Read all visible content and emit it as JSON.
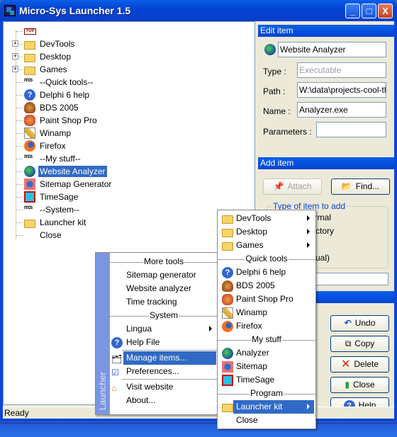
{
  "window": {
    "title": "Micro-Sys Launcher 1.5",
    "minimize": "_",
    "maximize": "□",
    "close": "X"
  },
  "tree": [
    {
      "label": "",
      "icon": "top-tag-icon",
      "tag": "TOP"
    },
    {
      "label": "DevTools",
      "icon": "folder-icon",
      "expandable": true
    },
    {
      "label": "Desktop",
      "icon": "folder-icon",
      "expandable": true
    },
    {
      "label": "Games",
      "icon": "folder-icon",
      "expandable": true
    },
    {
      "label": "--Quick tools--",
      "icon": "separator-icon",
      "tag": "m:s"
    },
    {
      "label": "Delphi 6 help",
      "icon": "help-icon"
    },
    {
      "label": "BDS 2005",
      "icon": "bds-icon"
    },
    {
      "label": "Paint Shop Pro",
      "icon": "paintshop-icon"
    },
    {
      "label": "Winamp",
      "icon": "winamp-icon"
    },
    {
      "label": "Firefox",
      "icon": "firefox-icon"
    },
    {
      "label": "--My stuff--",
      "icon": "separator-icon",
      "tag": "m:s"
    },
    {
      "label": "Website Analyzer",
      "icon": "globe-icon",
      "selected": true
    },
    {
      "label": "Sitemap Generator",
      "icon": "sitemap-icon"
    },
    {
      "label": "TimeSage",
      "icon": "timesage-icon"
    },
    {
      "label": "--System--",
      "icon": "separator-icon",
      "tag": "m:s"
    },
    {
      "label": "Launcher kit",
      "icon": "folder-icon"
    },
    {
      "label": "Close",
      "icon": ""
    }
  ],
  "edit": {
    "header": "Edit item",
    "title_value": "Website Analyzer",
    "type_label": "Type :",
    "type_value": "Executable",
    "path_label": "Path :",
    "path_value": "W:\\data\\projects-cool-th",
    "name_label": "Name :",
    "name_value": "Analyzer.exe",
    "params_label": "Parameters :",
    "params_value": ""
  },
  "add": {
    "header": "Add item",
    "attach": "Attach",
    "find": "Find...",
    "group_title": "Type of item to add",
    "radio_file": "File / normal",
    "radio_dir_partial": "ctory",
    "radio_virtual_partial": "ual)"
  },
  "buttons": {
    "undo": "Undo",
    "copy": "Copy",
    "delete": "Delete",
    "close": "Close",
    "help": "Help"
  },
  "status": {
    "text": "Ready"
  },
  "menu_main": {
    "side_label": "Launcher",
    "items": [
      {
        "type": "header",
        "label": "More tools"
      },
      {
        "type": "item",
        "label": "Sitemap generator"
      },
      {
        "type": "item",
        "label": "Website analyzer"
      },
      {
        "type": "item",
        "label": "Time tracking"
      },
      {
        "type": "header",
        "label": "System"
      },
      {
        "type": "item",
        "label": "Lingua",
        "submenu": true
      },
      {
        "type": "item",
        "label": "Help File",
        "icon": "help-icon"
      },
      {
        "type": "item",
        "label": "Manage items...",
        "icon": "manage-icon",
        "highlighted": true
      },
      {
        "type": "item",
        "label": "Preferences...",
        "icon": "preferences-icon"
      },
      {
        "type": "item",
        "label": "Visit website",
        "icon": "home-icon"
      },
      {
        "type": "item",
        "label": "About..."
      }
    ]
  },
  "menu_sub": {
    "items": [
      {
        "type": "item",
        "label": "DevTools",
        "icon": "folder-icon",
        "submenu": true
      },
      {
        "type": "item",
        "label": "Desktop",
        "icon": "folder-icon",
        "submenu": true
      },
      {
        "type": "item",
        "label": "Games",
        "icon": "folder-icon",
        "submenu": true
      },
      {
        "type": "header",
        "label": "Quick tools"
      },
      {
        "type": "item",
        "label": "Delphi 6 help",
        "icon": "help-icon"
      },
      {
        "type": "item",
        "label": "BDS 2005",
        "icon": "bds-icon"
      },
      {
        "type": "item",
        "label": "Paint Shop Pro",
        "icon": "paintshop-icon"
      },
      {
        "type": "item",
        "label": "Winamp",
        "icon": "winamp-icon"
      },
      {
        "type": "item",
        "label": "Firefox",
        "icon": "firefox-icon"
      },
      {
        "type": "header",
        "label": "My stuff"
      },
      {
        "type": "item",
        "label": "Analyzer",
        "icon": "globe-icon"
      },
      {
        "type": "item",
        "label": "Sitemap",
        "icon": "sitemap-icon"
      },
      {
        "type": "item",
        "label": "TimeSage",
        "icon": "timesage-icon"
      },
      {
        "type": "header",
        "label": "Program"
      },
      {
        "type": "item",
        "label": "Launcher kit",
        "icon": "folder-icon",
        "submenu": true,
        "highlighted": true
      },
      {
        "type": "item",
        "label": "Close"
      }
    ]
  }
}
